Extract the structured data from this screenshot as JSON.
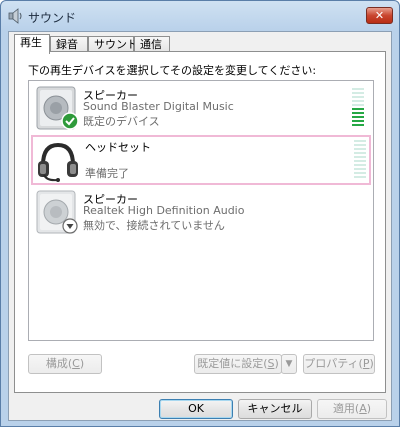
{
  "window": {
    "title": "サウンド",
    "close_label": "✕"
  },
  "tabs": [
    {
      "label": "再生",
      "active": true
    },
    {
      "label": "録音",
      "active": false
    },
    {
      "label": "サウンド",
      "active": false
    },
    {
      "label": "通信",
      "active": false
    }
  ],
  "instruction": "下の再生デバイスを選択してその設定を変更してください:",
  "devices": [
    {
      "name": "スピーカー",
      "line1": "Sound Blaster Digital Music",
      "line2": "既定のデバイス",
      "icon": "speaker-icon",
      "badge": "default-check-icon",
      "level": 0.45,
      "selected": false
    },
    {
      "name": "ヘッドセット",
      "line1": "",
      "line2": "準備完了",
      "icon": "headset-icon",
      "badge": "",
      "level": 0,
      "selected": true
    },
    {
      "name": "スピーカー",
      "line1": "Realtek High Definition Audio",
      "line2": "無効で、接続されていません",
      "icon": "speaker-icon",
      "badge": "disabled-down-icon",
      "level": 0,
      "selected": false
    }
  ],
  "buttons": {
    "configure": {
      "text": "構成(",
      "key": "C",
      "end": ")"
    },
    "set_default": {
      "text": "既定値に設定(",
      "key": "S",
      "end": ")"
    },
    "properties": {
      "text": "プロパティ(",
      "key": "P",
      "end": ")"
    },
    "ok": "OK",
    "cancel": "キャンセル",
    "apply": {
      "text": "適用(",
      "key": "A",
      "end": ")"
    }
  },
  "colors": {
    "meter_active": "#26a845",
    "meter_inactive": "#d4ece4",
    "selection_border": "#f0b9d6",
    "check_badge": "#2e9a3a"
  }
}
